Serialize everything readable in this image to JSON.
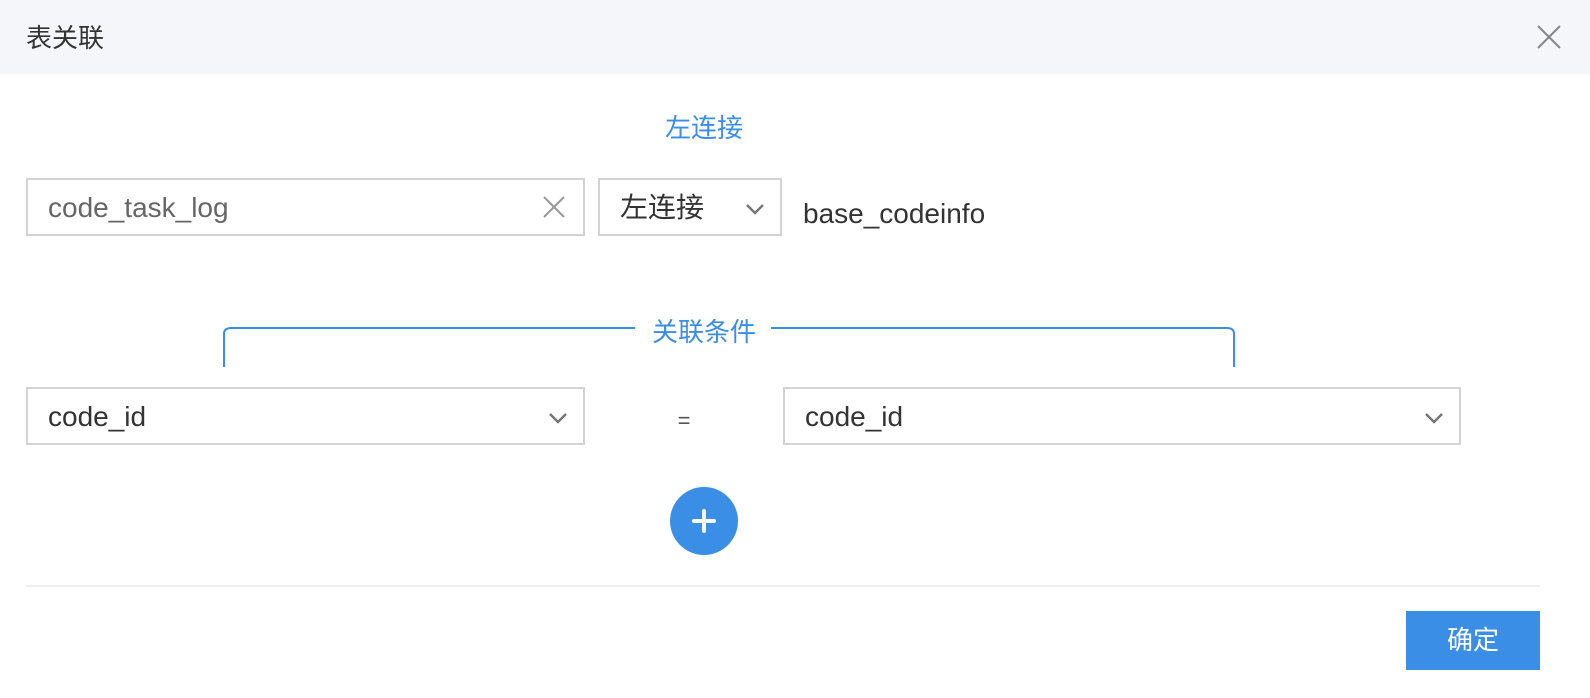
{
  "dialog": {
    "title": "表关联",
    "close_icon": "close-icon"
  },
  "join": {
    "type_title": "左连接",
    "left_table": "code_task_log",
    "join_type": "左连接",
    "right_table": "base_codeinfo"
  },
  "conditions": {
    "title": "关联条件",
    "rows": [
      {
        "left_field": "code_id",
        "operator": "=",
        "right_field": "code_id"
      }
    ],
    "add_icon": "plus-icon"
  },
  "footer": {
    "confirm_label": "确定"
  },
  "colors": {
    "accent": "#3a8ee6",
    "header_bg": "#f5f6fa",
    "border": "#d3d3d3"
  }
}
